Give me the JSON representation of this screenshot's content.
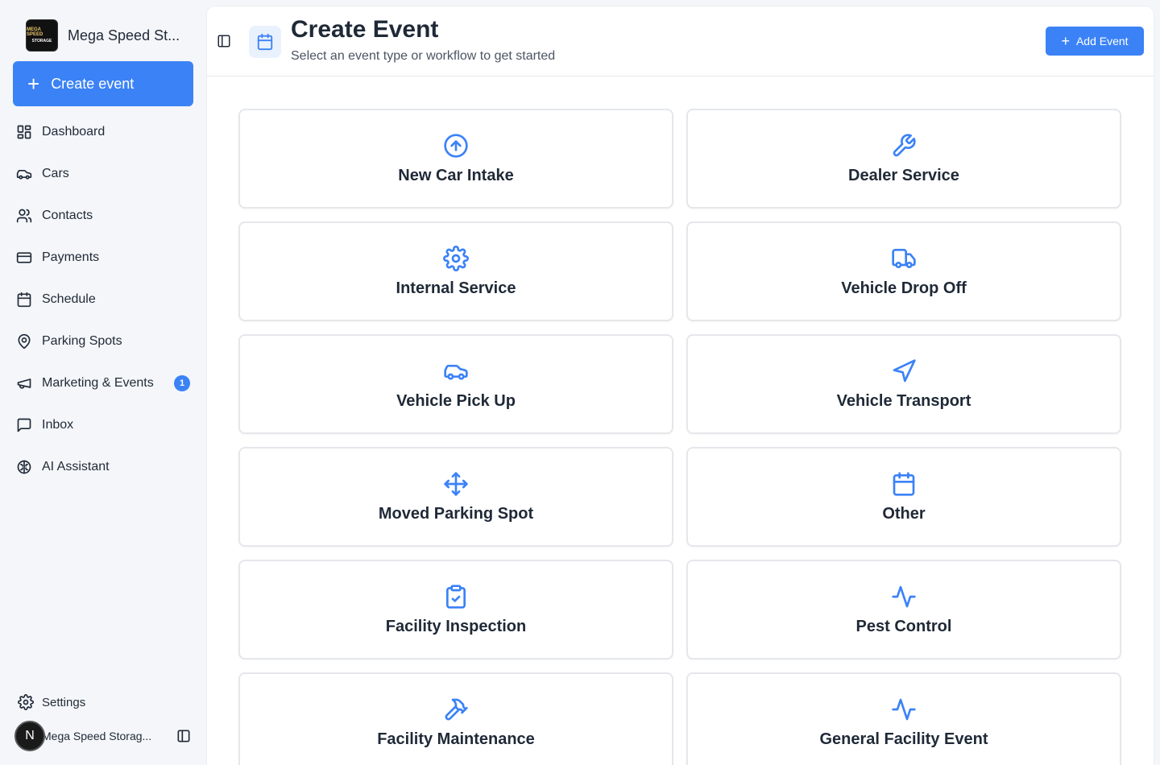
{
  "sidebar": {
    "brand_name": "Mega Speed St...",
    "brand_logo_line1": "MEGA SPEED",
    "brand_logo_line2": "STORAGE",
    "create_label": "Create event",
    "items": [
      {
        "label": "Dashboard",
        "icon": "dashboard-icon"
      },
      {
        "label": "Cars",
        "icon": "car-icon"
      },
      {
        "label": "Contacts",
        "icon": "users-icon"
      },
      {
        "label": "Payments",
        "icon": "credit-card-icon"
      },
      {
        "label": "Schedule",
        "icon": "calendar-icon"
      },
      {
        "label": "Parking Spots",
        "icon": "map-pin-icon"
      },
      {
        "label": "Marketing & Events",
        "icon": "megaphone-icon",
        "badge": "1"
      },
      {
        "label": "Inbox",
        "icon": "message-icon"
      },
      {
        "label": "AI Assistant",
        "icon": "brain-icon"
      }
    ],
    "settings_label": "Settings",
    "user_initial": "N",
    "user_name": "Mega Speed Storag..."
  },
  "header": {
    "title": "Create Event",
    "subtitle": "Select an event type or workflow to get started",
    "add_label": "Add Event"
  },
  "cards": [
    {
      "label": "New Car Intake",
      "icon": "arrow-up-circle-icon"
    },
    {
      "label": "Dealer Service",
      "icon": "wrench-icon"
    },
    {
      "label": "Internal Service",
      "icon": "gear-icon"
    },
    {
      "label": "Vehicle Drop Off",
      "icon": "truck-icon"
    },
    {
      "label": "Vehicle Pick Up",
      "icon": "car-icon"
    },
    {
      "label": "Vehicle Transport",
      "icon": "navigation-icon"
    },
    {
      "label": "Moved Parking Spot",
      "icon": "move-icon"
    },
    {
      "label": "Other",
      "icon": "calendar-icon"
    },
    {
      "label": "Facility Inspection",
      "icon": "clipboard-check-icon"
    },
    {
      "label": "Pest Control",
      "icon": "activity-icon"
    },
    {
      "label": "Facility Maintenance",
      "icon": "hammer-icon"
    },
    {
      "label": "General Facility Event",
      "icon": "activity-icon"
    }
  ],
  "colors": {
    "accent": "#3b82f6",
    "sidebar_bg": "#f4f6f9",
    "text": "#1f2937"
  }
}
